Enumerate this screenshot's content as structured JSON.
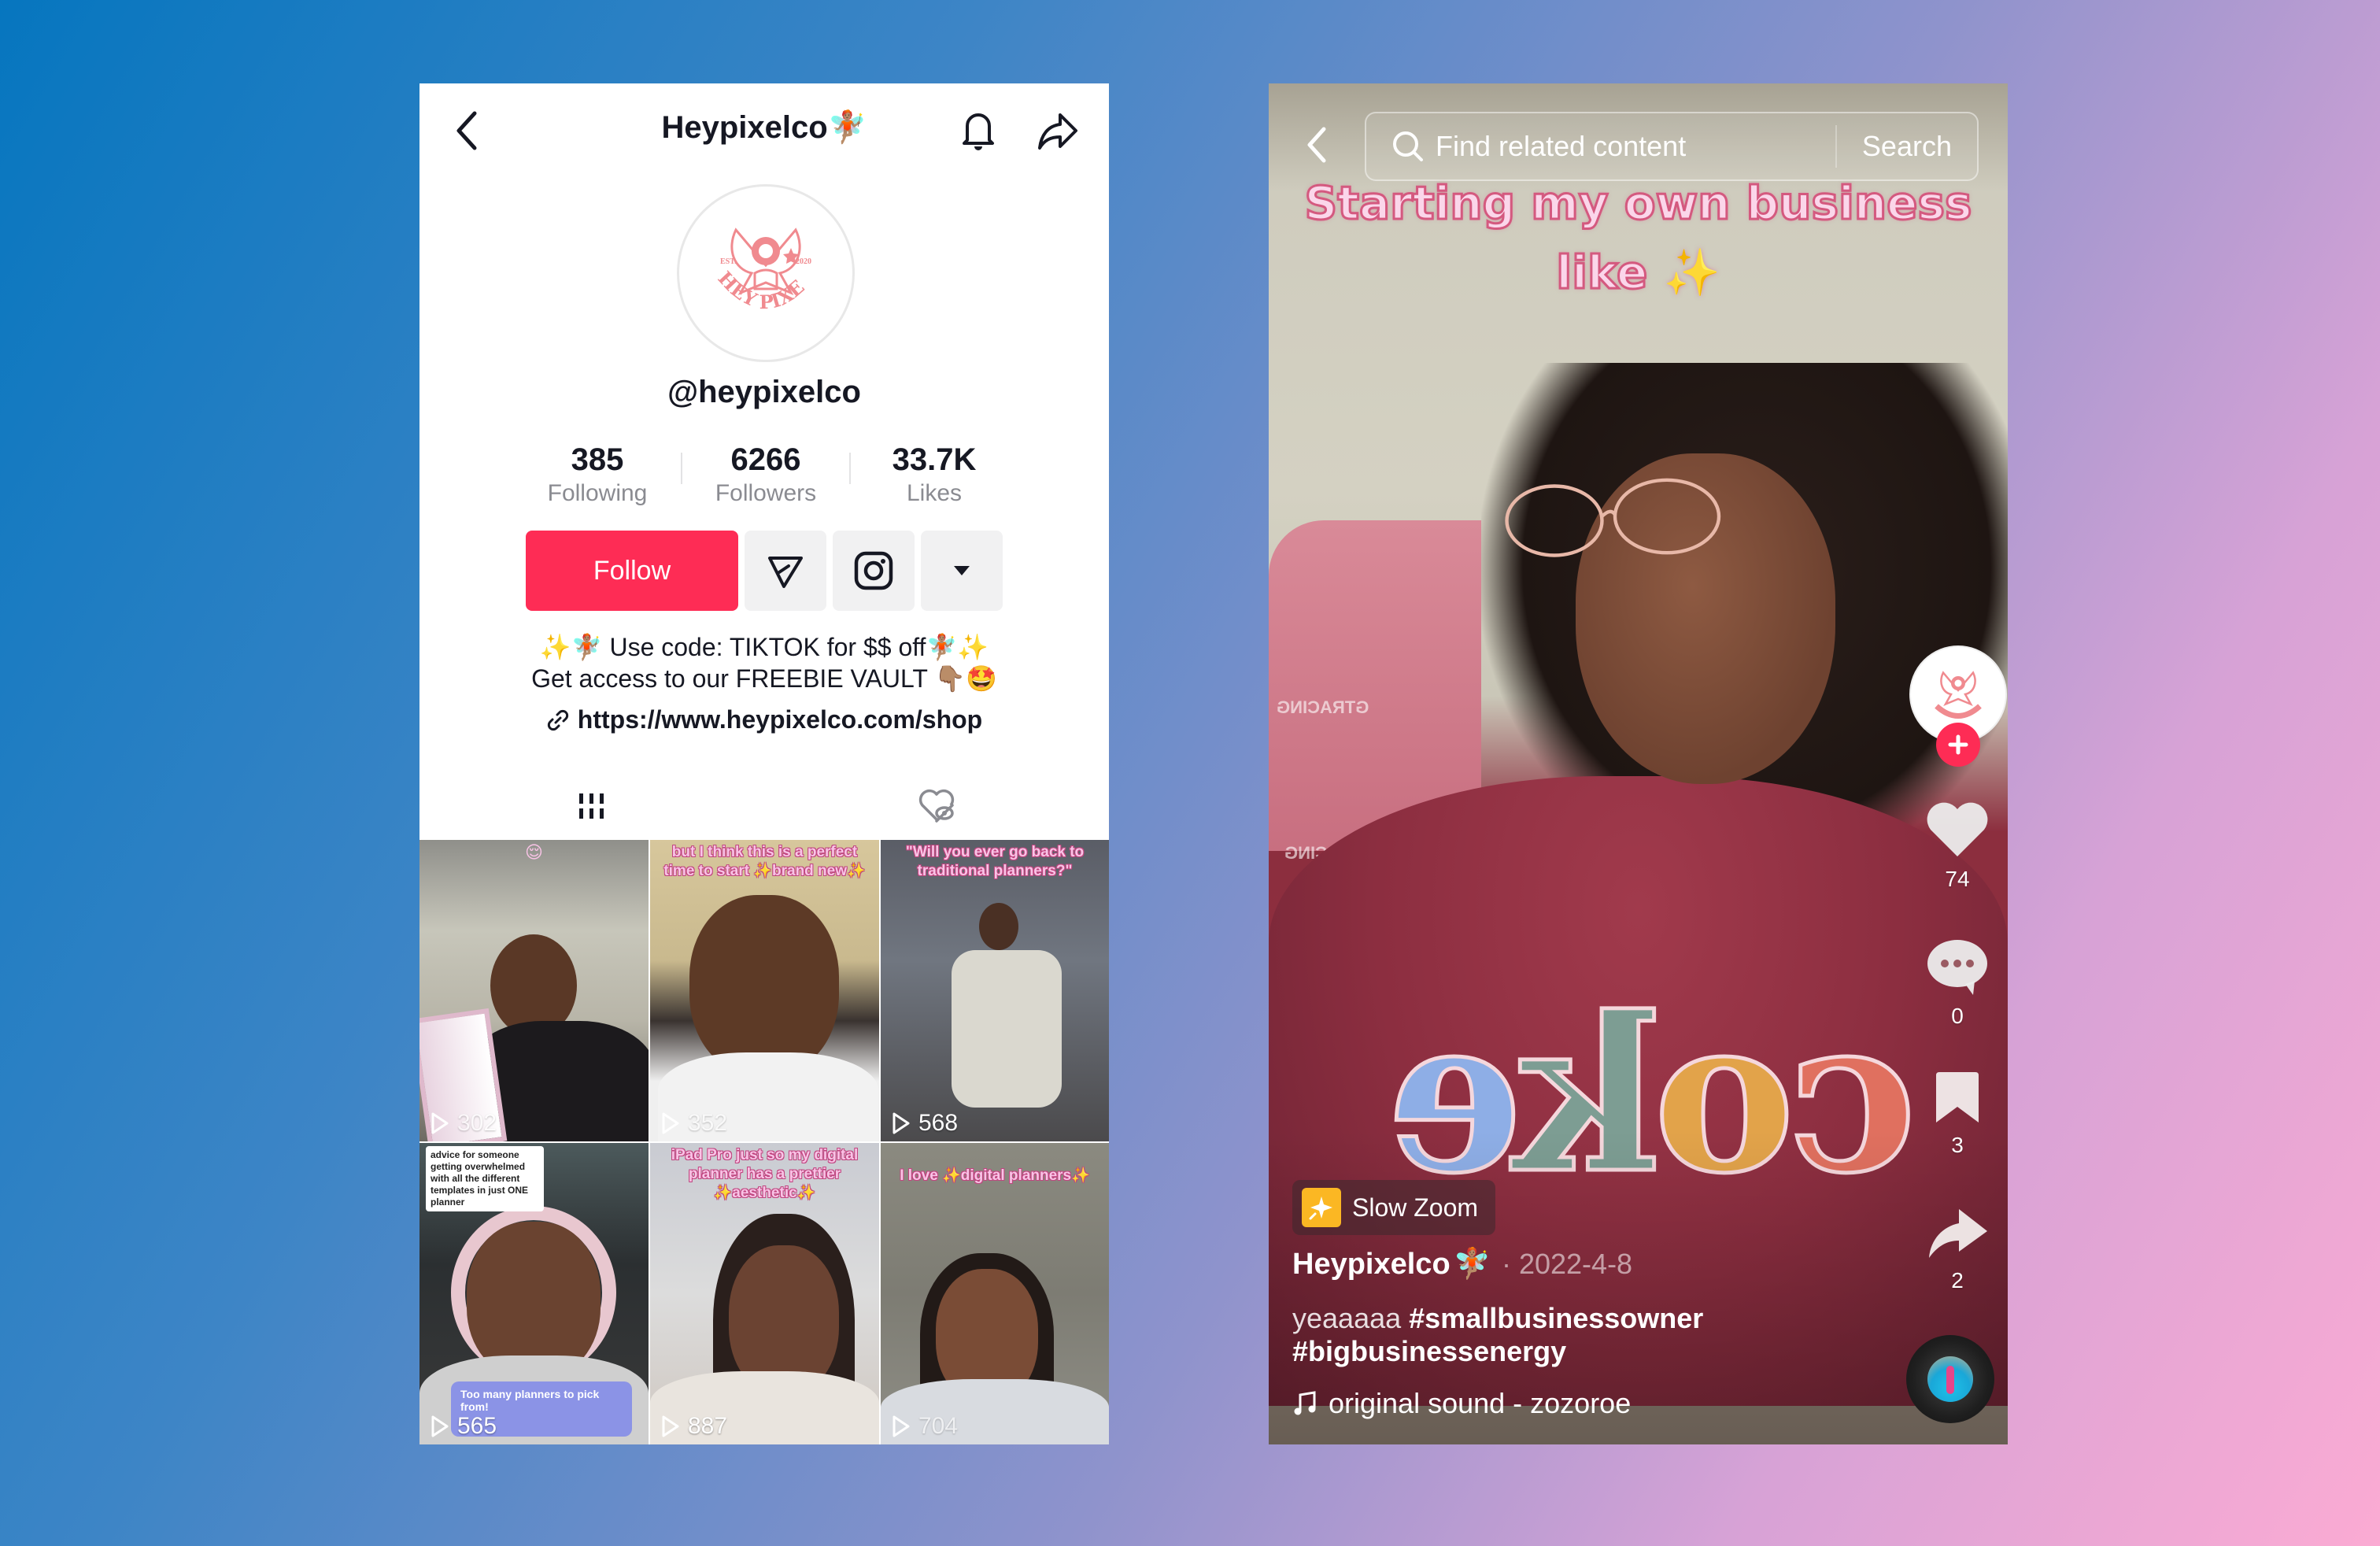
{
  "profile": {
    "header": {
      "title": "Heypixelco",
      "title_emoji": "🧚🏽",
      "back_icon": "chevron-left-icon",
      "bell_icon": "bell-icon",
      "share_icon": "share-arrow-icon"
    },
    "avatar": {
      "brand_text": "HEY PIXEL",
      "est_left": "EST.",
      "est_right": "2020",
      "color": "#f08a8f"
    },
    "handle": "@heypixelco",
    "stats": [
      {
        "value": "385",
        "label": "Following"
      },
      {
        "value": "6266",
        "label": "Followers"
      },
      {
        "value": "33.7K",
        "label": "Likes"
      }
    ],
    "actions": {
      "follow_label": "Follow",
      "follow_color": "#fe2c55",
      "message_icon": "send-message-icon",
      "instagram_icon": "instagram-icon",
      "more_icon": "caret-down-icon"
    },
    "bio": {
      "line1": "✨🧚🏽 Use code: TIKTOK for $$ off🧚🏽✨",
      "line2": "Get access to our FREEBIE VAULT 👇🏽🤩"
    },
    "link": {
      "icon": "link-icon",
      "url": "https://www.heypixelco.com/shop"
    },
    "tabs": [
      {
        "name": "videos",
        "icon": "grid-videos-icon",
        "active": true
      },
      {
        "name": "liked",
        "icon": "liked-private-icon",
        "active": false
      }
    ],
    "videos": [
      {
        "caption": "😌",
        "views": "302"
      },
      {
        "caption": "but I think this is a perfect time to start ✨brand new✨",
        "views": "352"
      },
      {
        "caption": "\"Will you ever go back to traditional planners?\"",
        "views": "568"
      },
      {
        "caption": "advice for someone getting overwhelmed with all the different templates in just ONE planner",
        "bubble": "Too many planners to pick from!",
        "views": "565"
      },
      {
        "caption": "iPad Pro just so my digital planner has a prettier ✨aesthetic✨",
        "views": "887"
      },
      {
        "caption": "I love ✨digital planners✨",
        "views": "704"
      }
    ]
  },
  "video": {
    "back_icon": "chevron-left-icon",
    "search": {
      "placeholder": "Find related content",
      "value": "",
      "button_label": "Search",
      "icon": "search-icon"
    },
    "overlay_text": {
      "line1": "Starting my own business",
      "line2": "like",
      "line2_emoji": "✨"
    },
    "shirt_text": "coke",
    "chair_text": "GTRACING",
    "side_actions": {
      "follow_plus_icon": "plus-icon",
      "likes": "74",
      "comments": "0",
      "saves": "3",
      "shares": "2"
    },
    "effect": {
      "icon": "magic-wand-icon",
      "label": "Slow Zoom"
    },
    "author": {
      "name": "Heypixelco",
      "emoji": "🧚🏽",
      "date": "· 2022-4-8"
    },
    "description": {
      "text": "yeaaaaa",
      "hashtags": [
        "#smallbusinessowner",
        "#bigbusinessenergy"
      ]
    },
    "sound": {
      "icon": "music-note-icon",
      "label": "original sound - zozoroe"
    }
  }
}
